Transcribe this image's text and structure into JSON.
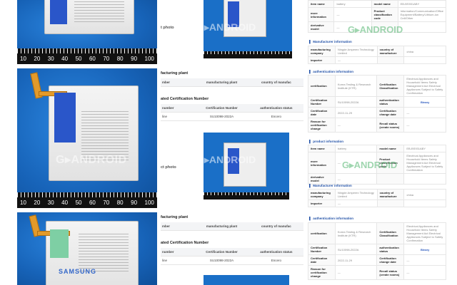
{
  "watermark": "G▸ANDROID",
  "photos": {
    "ruler_numbers_top": [
      "10",
      "20",
      "30",
      "40",
      "50",
      "60",
      "70",
      "80",
      "90",
      "100"
    ],
    "ruler_numbers_mid": [
      "10",
      "20",
      "30",
      "40",
      "50",
      "60",
      "70",
      "80",
      "90",
      "100"
    ],
    "brand_label": "SAMSUNG"
  },
  "middle": {
    "top_caption": "t photo",
    "mid_caption": "ct photo",
    "block2": {
      "plant_section": "facturing plant",
      "plant_headers": [
        "mber",
        "manufacturing plant",
        "country of manufac"
      ],
      "cert_section": "ated Certification Number",
      "cert_headers": [
        "number",
        "Certification Number",
        "authentication status"
      ],
      "cert_row": [
        "line",
        "SU10098-2022A",
        "Encero"
      ]
    },
    "block3": {
      "plant_section": "facturing plant",
      "plant_headers": [
        "mber",
        "manufacturing plant",
        "country of manufac"
      ],
      "cert_section": "ated Certification Number",
      "cert_headers": [
        "number",
        "Certification Number",
        "authentication status"
      ],
      "cert_row": [
        "line",
        "SU10098-2022A",
        "Encero"
      ]
    }
  },
  "right": {
    "top": {
      "row1": [
        "item name",
        "battery",
        "model name",
        "EB-BS931ABY"
      ],
      "row2": [
        "more information",
        "—",
        "Product classification code",
        "Information/Communication/Office Equipment/Battery/Lithium-ion Cell/Other"
      ],
      "row3": [
        "derivative model",
        "—",
        "",
        ""
      ],
      "manufacturer_section": "Manufacturer information",
      "mrow1": [
        "manufacturing company",
        "Ningde Amperex Technology Limited",
        "country of manufacture",
        "china"
      ],
      "mrow2": [
        "importer",
        "—",
        "",
        ""
      ]
    },
    "mid": {
      "auth_section": "authentication information",
      "arow1": [
        "certification",
        "Korea Testing & Research Institute (KTR)",
        "Certification Classification",
        "Electrical Appliances and Household Items Safety Management Act Electrical Appliances Subject to Safety Confirmation"
      ],
      "arow2": [
        "Certification Number",
        "SU10098-2022A",
        "authentication status",
        "Binary"
      ],
      "arow3": [
        "Certification date",
        "2022-11-29",
        "Certification change date",
        "—"
      ],
      "arow4": [
        "Reason for certification change",
        "—",
        "Recall status (create rooms)",
        "—"
      ],
      "product_section": "product information",
      "prow1": [
        "item name",
        "battery",
        "model name",
        "EB-BS931ABY"
      ],
      "prow2": [
        "more information",
        "—",
        "Product classification code",
        "Electrical Appliances and Household Items Safety Management Act Electrical Appliances Subject to Safety Confirmation"
      ],
      "prow3": [
        "derivative model",
        "—",
        "",
        ""
      ],
      "manufacturer_section": "Manufacturer information",
      "mrow1": [
        "manufacturing company",
        "Ningde Amperex Technology Limited",
        "country of manufacture",
        "china"
      ],
      "mrow2": [
        "importer",
        "—",
        "",
        ""
      ]
    },
    "bottom": {
      "auth_section": "authentication information",
      "arow1": [
        "certification",
        "Korea Testing & Research Institute (KTR)",
        "Certification Classification",
        "Electrical Appliances and Household Items Safety Management Act Electrical Appliances Subject to Safety Confirmation"
      ],
      "arow2": [
        "Certification Number",
        "SU10098-2022A",
        "authentication status",
        "Binary"
      ],
      "arow3": [
        "Certification date",
        "2022-11-29",
        "Certification change date",
        "—"
      ],
      "arow4": [
        "Reason for certification change",
        "—",
        "Recall status (create rooms)",
        "—"
      ]
    }
  }
}
